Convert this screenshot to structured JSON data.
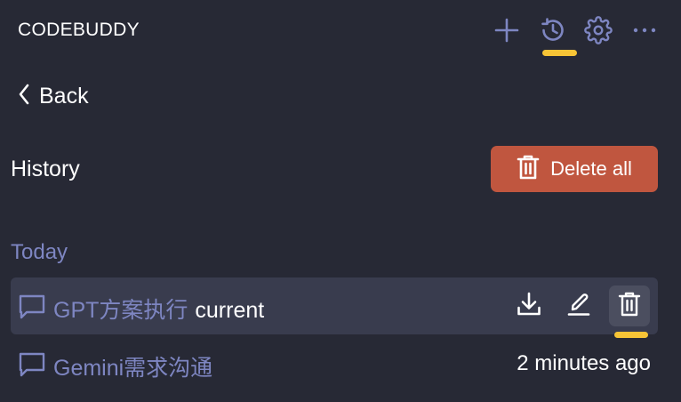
{
  "header": {
    "app_title": "CODEBUDDY",
    "icons": [
      "plus-icon",
      "history-icon",
      "gear-icon",
      "more-horizontal-icon"
    ],
    "active_icon": "history-icon"
  },
  "nav": {
    "back_label": "Back"
  },
  "history": {
    "title": "History",
    "delete_all_label": "Delete all",
    "groups": [
      {
        "label": "Today",
        "items": [
          {
            "title": "GPT方案执行",
            "tag": "current",
            "selected": true,
            "actions": [
              "download-icon",
              "edit-icon",
              "trash-icon"
            ],
            "hovered_action": "trash-icon"
          },
          {
            "title": "Gemini需求沟通",
            "time": "2 minutes ago",
            "selected": false
          }
        ]
      }
    ]
  },
  "colors": {
    "background": "#272935",
    "selected_row": "#393c4e",
    "accent_text": "#7e86c2",
    "danger": "#c0563f",
    "indicator": "#f7c436"
  }
}
